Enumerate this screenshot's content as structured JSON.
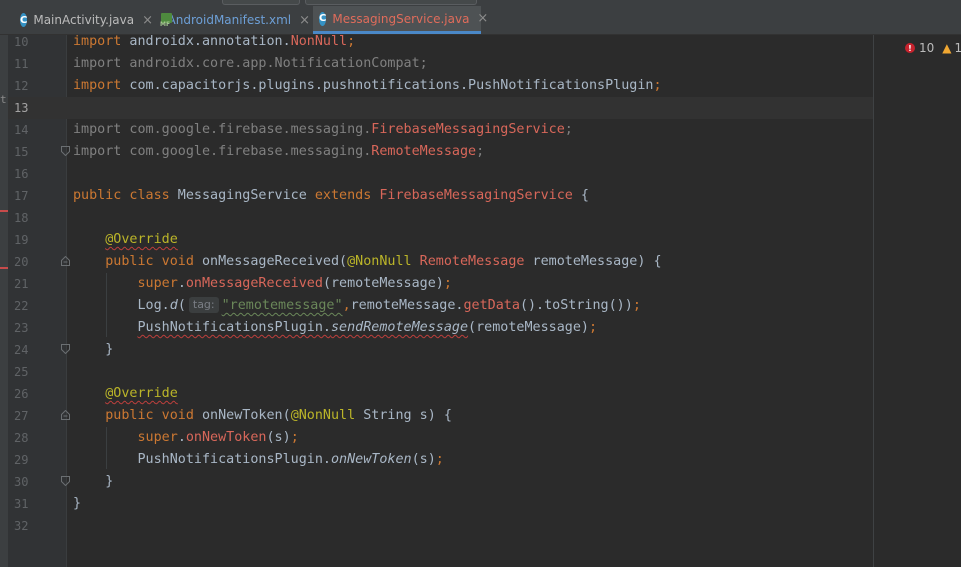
{
  "tabs": [
    {
      "label": "MainActivity.java",
      "icon": "java-class-icon",
      "icon_letter": "C",
      "active": false
    },
    {
      "label": "AndroidManifest.xml",
      "icon": "manifest-xml-icon",
      "icon_letter": "MF",
      "active": false
    },
    {
      "label": "MessagingService.java",
      "icon": "java-class-icon",
      "icon_letter": "C",
      "active": true
    }
  ],
  "close_glyph": "×",
  "inspections": {
    "errors": "10",
    "warnings": "1"
  },
  "line_numbers": [
    "10",
    "11",
    "12",
    "13",
    "14",
    "15",
    "16",
    "17",
    "18",
    "19",
    "20",
    "21",
    "22",
    "23",
    "24",
    "25",
    "26",
    "27",
    "28",
    "29",
    "30",
    "31",
    "32"
  ],
  "current_line": "13",
  "hint_tag": "tag:",
  "code": {
    "l10": {
      "kw": "import",
      "pkg": " androidx.annotation.",
      "cls": "NonNull",
      "semi": ";"
    },
    "l11": {
      "text": "import androidx.core.app.NotificationCompat;"
    },
    "l12": {
      "kw": "import",
      "rest": " com.capacitorjs.plugins.pushnotifications.PushNotificationsPlugin",
      "semi": ";"
    },
    "l14": {
      "kw": "import",
      "pkg": " com.google.firebase.messaging.",
      "cls": "FirebaseMessagingService",
      "semi": ";"
    },
    "l15": {
      "kw": "import",
      "pkg": " com.google.firebase.messaging.",
      "cls": "RemoteMessage",
      "semi": ";"
    },
    "l17": {
      "kw1": "public class",
      "name": " MessagingService ",
      "kw2": "extends",
      "sup": " FirebaseMessagingService",
      "brace": " {"
    },
    "l19": {
      "ann": "@Override"
    },
    "l20": {
      "kw": "public void",
      "method": " onMessageReceived(",
      "ann": "@NonNull",
      "type": " RemoteMessage",
      "rest": " remoteMessage) {"
    },
    "l21": {
      "kw": "super",
      "dot": ".",
      "method": "onMessageReceived",
      "rest": "(remoteMessage)",
      "semi": ";"
    },
    "l22": {
      "pre": "Log.",
      "method": "d",
      "open": "(",
      "str": "\"remotemessage\"",
      "comma": ",",
      "mid": "remoteMessage.",
      "call": "getData",
      "rest": "().toString())",
      "semi": ";"
    },
    "l23": {
      "cls": "PushNotificationsPlugin.",
      "method": "sendRemoteMessage",
      "rest": "(remoteMessage)",
      "semi": ";"
    },
    "l24": {
      "text": "}"
    },
    "l26": {
      "ann": "@Override"
    },
    "l27": {
      "kw": "public void",
      "method": " onNewToken(",
      "ann": "@NonNull",
      "rest": " String s) {"
    },
    "l28": {
      "kw": "super",
      "dot": ".",
      "method": "onNewToken",
      "rest": "(s)",
      "semi": ";"
    },
    "l29": {
      "cls": "PushNotificationsPlugin.",
      "method": "onNewToken",
      "rest": "(s)",
      "semi": ";"
    },
    "l30": {
      "text": "}"
    },
    "l31": {
      "text": "}"
    }
  },
  "colors": {
    "background": "#2b2b2b",
    "keyword": "#cc7832",
    "annotation": "#bbb529",
    "error_symbol": "#d8675a",
    "string": "#6a8759",
    "default": "#a9b7c6",
    "tab_underline": "#4a88c7"
  }
}
